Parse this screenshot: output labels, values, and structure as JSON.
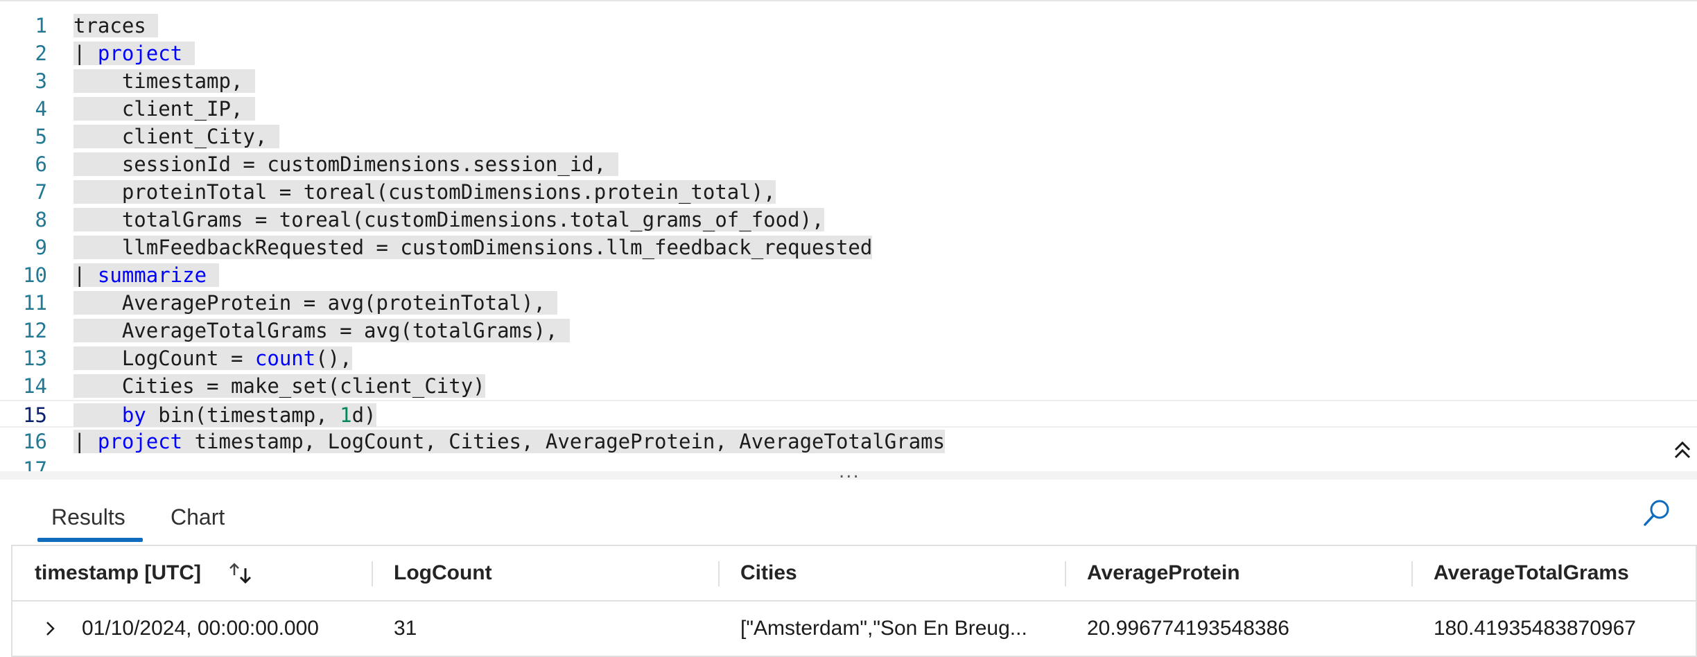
{
  "editor": {
    "lines": [
      {
        "num": "1",
        "segs": [
          {
            "t": "traces ",
            "c": ""
          }
        ]
      },
      {
        "num": "2",
        "segs": [
          {
            "t": "| ",
            "c": ""
          },
          {
            "t": "project",
            "c": "kw"
          },
          {
            "t": " ",
            "c": ""
          }
        ]
      },
      {
        "num": "3",
        "segs": [
          {
            "t": "    timestamp, ",
            "c": ""
          }
        ]
      },
      {
        "num": "4",
        "segs": [
          {
            "t": "    client_IP, ",
            "c": ""
          }
        ]
      },
      {
        "num": "5",
        "segs": [
          {
            "t": "    client_City, ",
            "c": ""
          }
        ]
      },
      {
        "num": "6",
        "segs": [
          {
            "t": "    sessionId = customDimensions.session_id, ",
            "c": ""
          }
        ]
      },
      {
        "num": "7",
        "segs": [
          {
            "t": "    proteinTotal = toreal(customDimensions.protein_total),",
            "c": ""
          }
        ]
      },
      {
        "num": "8",
        "segs": [
          {
            "t": "    totalGrams = toreal(customDimensions.total_grams_of_food),",
            "c": ""
          }
        ]
      },
      {
        "num": "9",
        "segs": [
          {
            "t": "    llmFeedbackRequested = customDimensions.llm_feedback_requested",
            "c": ""
          }
        ]
      },
      {
        "num": "10",
        "segs": [
          {
            "t": "| ",
            "c": ""
          },
          {
            "t": "summarize",
            "c": "kw"
          },
          {
            "t": " ",
            "c": ""
          }
        ]
      },
      {
        "num": "11",
        "segs": [
          {
            "t": "    AverageProtein = avg(proteinTotal), ",
            "c": ""
          }
        ]
      },
      {
        "num": "12",
        "segs": [
          {
            "t": "    AverageTotalGrams = avg(totalGrams), ",
            "c": ""
          }
        ]
      },
      {
        "num": "13",
        "segs": [
          {
            "t": "    LogCount = ",
            "c": ""
          },
          {
            "t": "count",
            "c": "kw"
          },
          {
            "t": "(),",
            "c": ""
          }
        ]
      },
      {
        "num": "14",
        "segs": [
          {
            "t": "    Cities = make_set(client_City)",
            "c": ""
          }
        ]
      },
      {
        "num": "15",
        "segs": [
          {
            "t": "    ",
            "c": ""
          },
          {
            "t": "by",
            "c": "kw"
          },
          {
            "t": " bin(timestamp, ",
            "c": ""
          },
          {
            "t": "1",
            "c": "num"
          },
          {
            "t": "d)",
            "c": ""
          }
        ],
        "current": true
      },
      {
        "num": "16",
        "segs": [
          {
            "t": "| ",
            "c": ""
          },
          {
            "t": "project",
            "c": "kw"
          },
          {
            "t": " timestamp, LogCount, Cities, AverageProtein, AverageTotalGrams",
            "c": ""
          }
        ]
      },
      {
        "num": "17",
        "segs": []
      }
    ],
    "splitter_dots": "...",
    "collapse_icon": "double-chevron-up-icon"
  },
  "tabs": [
    {
      "label": "Results",
      "active": true
    },
    {
      "label": "Chart",
      "active": false
    }
  ],
  "search_icon": "search-icon",
  "grid": {
    "columns": [
      "timestamp [UTC]",
      "LogCount",
      "Cities",
      "AverageProtein",
      "AverageTotalGrams"
    ],
    "rows": [
      [
        "01/10/2024, 00:00:00.000",
        "31",
        "[\"Amsterdam\",\"Son En Breug...",
        "20.996774193548386",
        "180.41935483870967"
      ]
    ]
  },
  "colors": {
    "accent": "#0f6cbd",
    "keyword": "#0000ff",
    "number": "#098658",
    "line_number": "#237893",
    "selection": "#e5e5e5"
  }
}
